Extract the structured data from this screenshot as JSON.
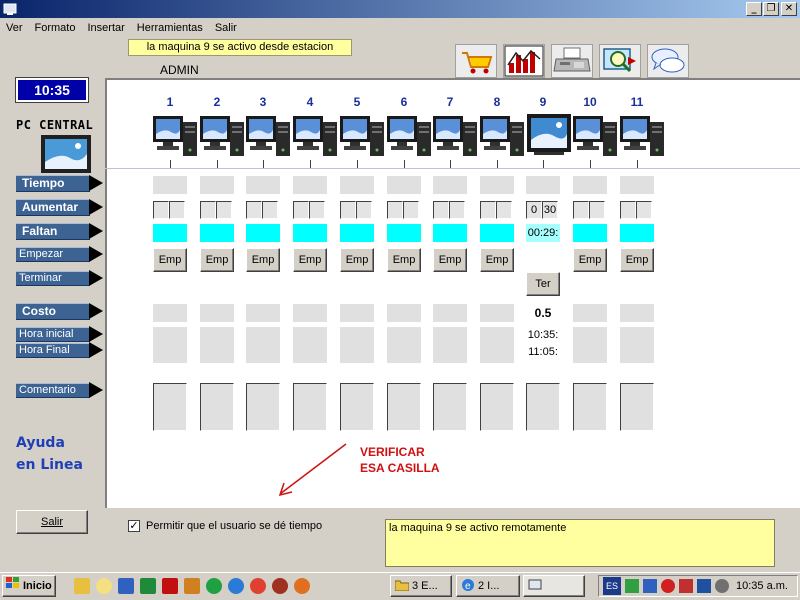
{
  "menu": [
    "Ver",
    "Formato",
    "Insertar",
    "Herramientas",
    "Salir"
  ],
  "window_buttons": {
    "minimize": "_",
    "restore": "❐",
    "close": "✕"
  },
  "status_top": "la maquina 9 se activo desde estacion",
  "admin_label": "ADMIN",
  "toolbar_icons": [
    "cart-icon",
    "chart-icon",
    "fax-icon",
    "search-screen-icon",
    "chat-icon"
  ],
  "clock": "10:35",
  "pc_central_label": "PC CENTRAL",
  "row_labels": {
    "tiempo": "Tiempo",
    "aumentar": "Aumentar",
    "faltan": "Faltan",
    "empezar": "Empezar",
    "terminar": "Terminar",
    "costo": "Costo",
    "hora_inicial": "Hora inicial",
    "hora_final": "Hora Final",
    "comentario": "Comentario"
  },
  "help_text_line1": "Ayuda",
  "help_text_line2": "en Linea",
  "salir_button": "Salir",
  "pc_numbers": [
    "1",
    "2",
    "3",
    "4",
    "5",
    "6",
    "7",
    "8",
    "9",
    "10",
    "11"
  ],
  "emp_label": "Emp",
  "ter_label": "Ter",
  "pc9": {
    "aumentar_left": "0",
    "aumentar_right": "30",
    "faltan": "00:29:",
    "costo": "0.5",
    "hora_inicial": "10:35:",
    "hora_final": "11:05:"
  },
  "annotation_line1": "VERIFICAR",
  "annotation_line2": "ESA CASILLA",
  "permit_checkbox_label": "Permitir que el usuario se dé tiempo",
  "permit_checked": "✓",
  "message_box": "la maquina 9 se activo remotamente",
  "taskbar": {
    "start": "Inicio",
    "task1": "3 E...",
    "task2": "2 I...",
    "tray_lang": "ES",
    "tray_clock": "10:35 a.m."
  },
  "colors": {
    "label_bg": "#3d6393",
    "cyan": "#00ffff",
    "annotation": "#d01010",
    "help": "#1e3fb8",
    "message_bg": "#ffffa0"
  }
}
